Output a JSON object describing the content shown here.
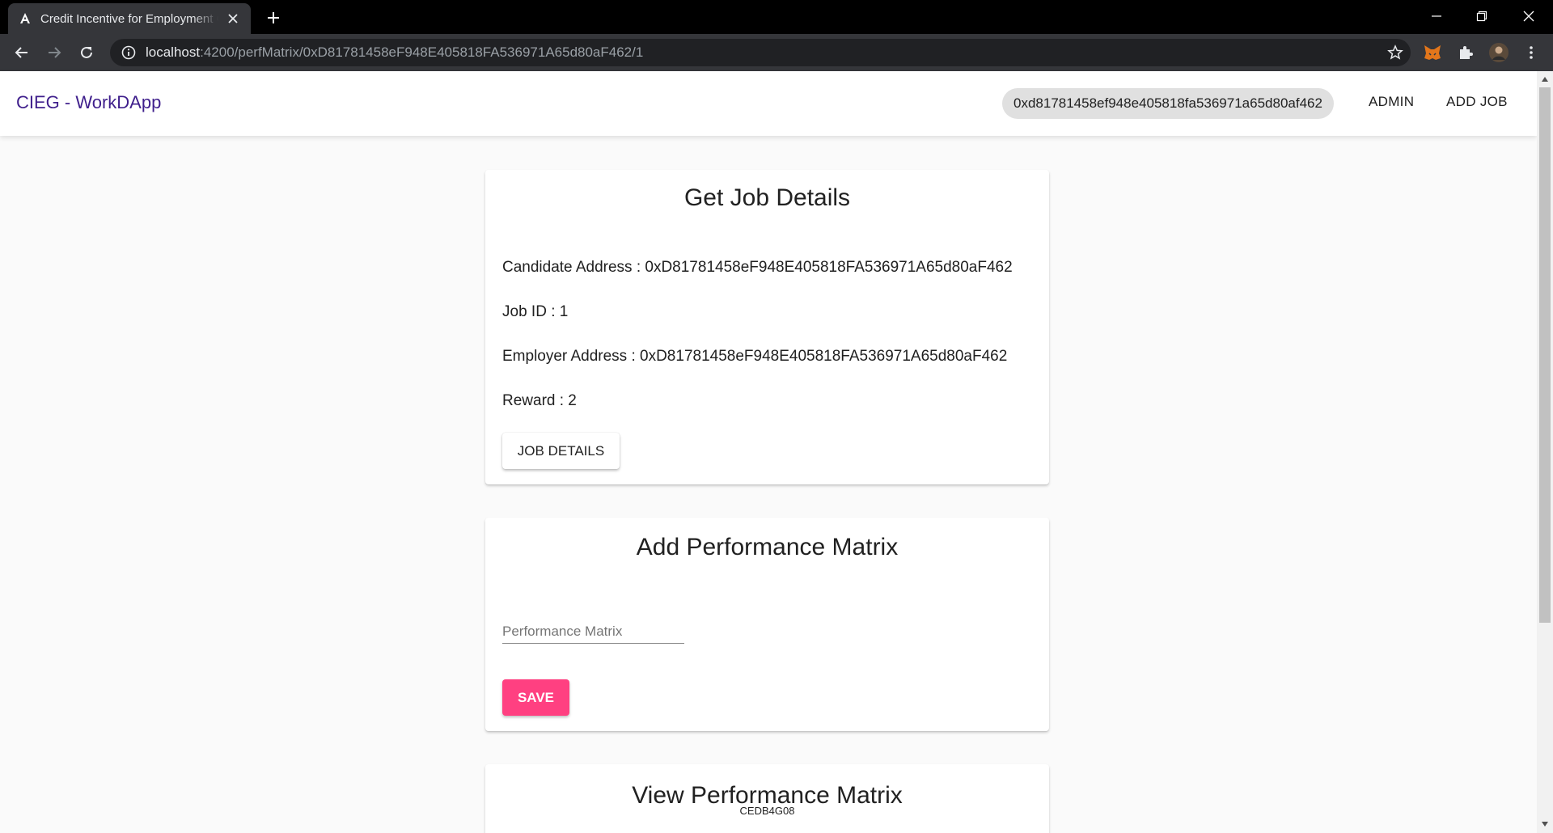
{
  "browser": {
    "tab_title": "Credit Incentive for Employment Generation",
    "url_host": "localhost",
    "url_rest": ":4200/perfMatrix/0xD81781458eF948E405818FA536971A65d80aF462/1"
  },
  "header": {
    "brand": "CIEG - WorkDApp",
    "wallet_address": "0xd81781458ef948e405818fa536971a65d80af462",
    "nav_admin": "ADMIN",
    "nav_add_job": "ADD JOB"
  },
  "job_details_card": {
    "title": "Get Job Details",
    "candidate_address": "Candidate Address : 0xD81781458eF948E405818FA536971A65d80aF462",
    "job_id": "Job ID : 1",
    "employer_address": "Employer Address : 0xD81781458eF948E405818FA536971A65d80aF462",
    "reward": "Reward : 2",
    "button_label": "JOB DETAILS"
  },
  "add_matrix_card": {
    "title": "Add Performance Matrix",
    "input_placeholder": "Performance Matrix",
    "input_value": "",
    "save_label": "SAVE"
  },
  "view_matrix_card": {
    "title": "View Performance Matrix",
    "matrix_code": "CEDB4G08"
  },
  "colors": {
    "brand": "#3f1f8c",
    "accent": "#ff4081"
  }
}
